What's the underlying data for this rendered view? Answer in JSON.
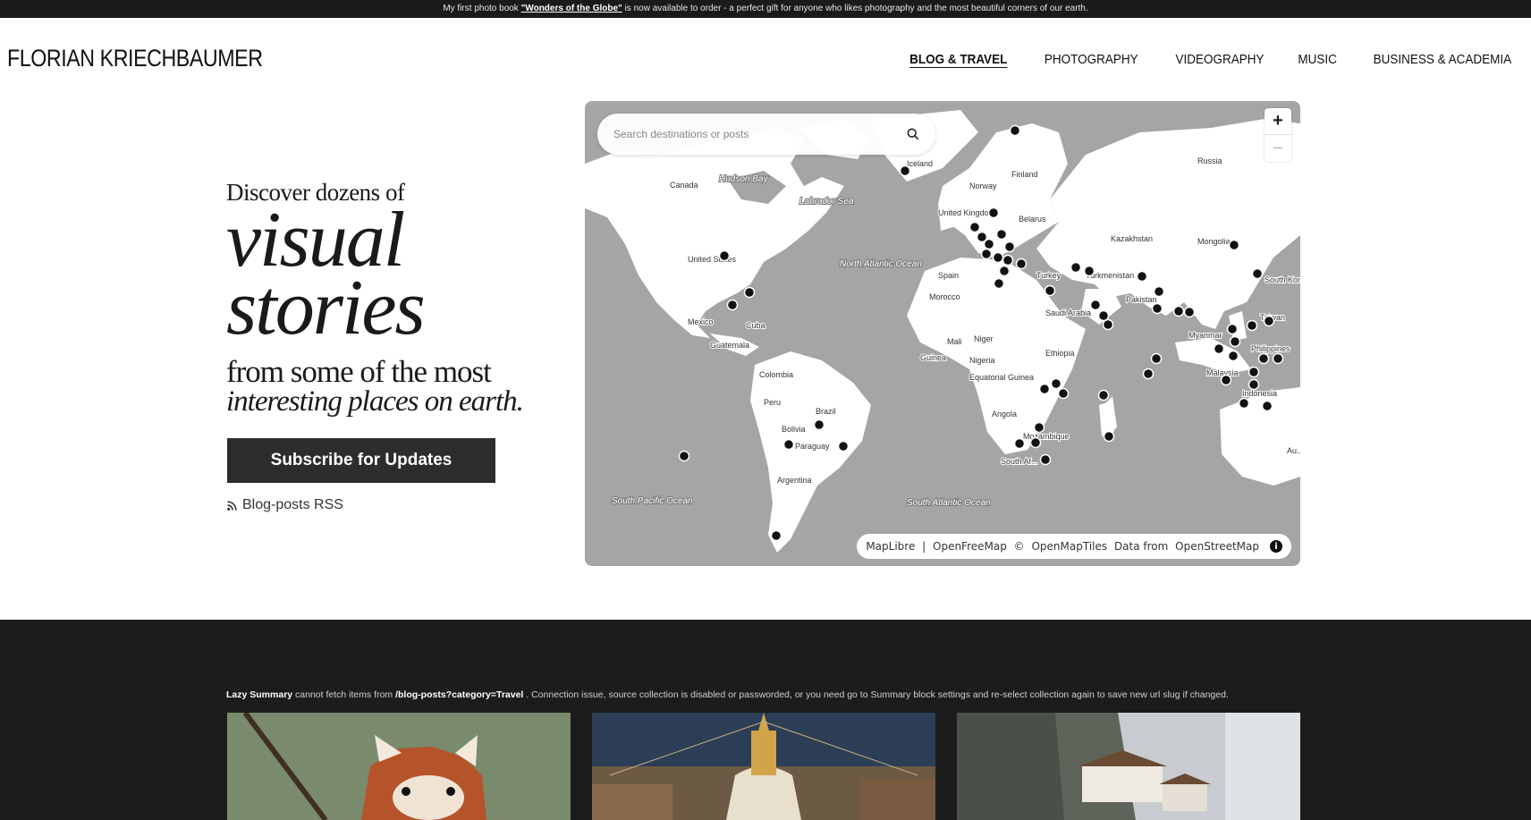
{
  "announcement": {
    "prefix": "My first photo book ",
    "book_link": "\"Wonders of the Globe\"",
    "suffix": " is now available to order - a perfect gift for anyone who likes photography and the most beautiful corners of our earth."
  },
  "site_title": "FLORIAN KRIECHBAUMER",
  "nav": [
    {
      "label": "BLOG & TRAVEL",
      "active": true
    },
    {
      "label": "PHOTOGRAPHY"
    },
    {
      "label": "VIDEOGRAPHY"
    },
    {
      "label": "MUSIC"
    },
    {
      "label": "BUSINESS & ACADEMIA"
    }
  ],
  "hero": {
    "line1": "Discover dozens of",
    "line2": "visual",
    "line3": "stories",
    "line4": "from some of the most",
    "line5": "interesting places on earth."
  },
  "subscribe_label": "Subscribe for Updates",
  "rss_label": "Blog-posts RSS",
  "map": {
    "search_placeholder": "Search destinations or posts",
    "zoom_in": "+",
    "zoom_out": "−",
    "attribution": {
      "maplibre": "MapLibre",
      "sep": " | ",
      "openfreemap": "OpenFreeMap",
      "copyright": " © ",
      "openmaptiles": "OpenMapTiles",
      "data_from": " Data from ",
      "osm": "OpenStreetMap"
    },
    "labels": {
      "canada": "Canada",
      "hudson": "Hudson Bay",
      "labrador": "Labrador Sea",
      "us": "United States",
      "mexico": "Mexico",
      "cuba": "Cuba",
      "guatemala": "Guatemala",
      "colombia": "Colombia",
      "peru": "Peru",
      "brazil": "Brazil",
      "bolivia": "Bolivia",
      "paraguay": "Paraguay",
      "argentina": "Argentina",
      "north_atlantic": "North Atlantic Ocean",
      "south_atlantic": "South Atlantic Ocean",
      "south_pacific": "South Pacific Ocean",
      "iceland": "Iceland",
      "norway": "Norway",
      "finland": "Finland",
      "uk": "United Kingdom",
      "belarus": "Belarus",
      "spain": "Spain",
      "morocco": "Morocco",
      "mali": "Mali",
      "niger": "Niger",
      "nigeria": "Nigeria",
      "guinea": "Guinea",
      "eq_guinea": "Equatorial Guinea",
      "angola": "Angola",
      "south_africa": "South Af...",
      "mozambique": "Mozambique",
      "ethiopia": "Ethiopia",
      "turkey": "Turkey",
      "saudi": "Saudi Arabia",
      "kazakhstan": "Kazakhstan",
      "turkmenistan": "Turkmenistan",
      "pakistan": "Pakistan",
      "russia": "Russia",
      "mongolia": "Mongolia",
      "south_korea": "South Korea",
      "myanmar": "Myanmar",
      "malaysia": "Malaysia",
      "indonesia": "Indonesia",
      "philippines": "Philippines",
      "taiwan": "Taiwan",
      "australia": "Au..."
    }
  },
  "lazy_summary": {
    "name": "Lazy Summary",
    "text1": " cannot fetch items from ",
    "path": "/blog-posts?category=Travel",
    "text2": " . Connection issue, source collection is disabled or passworded, or you need go to Summary block settings and re-select collection again to save new url slug if changed."
  },
  "colors": {
    "map_water": "#a5a5a5",
    "map_land": "#ffffff",
    "marker": "#111111",
    "dark_section": "#1c1c1c",
    "button": "#2d2d2d"
  }
}
